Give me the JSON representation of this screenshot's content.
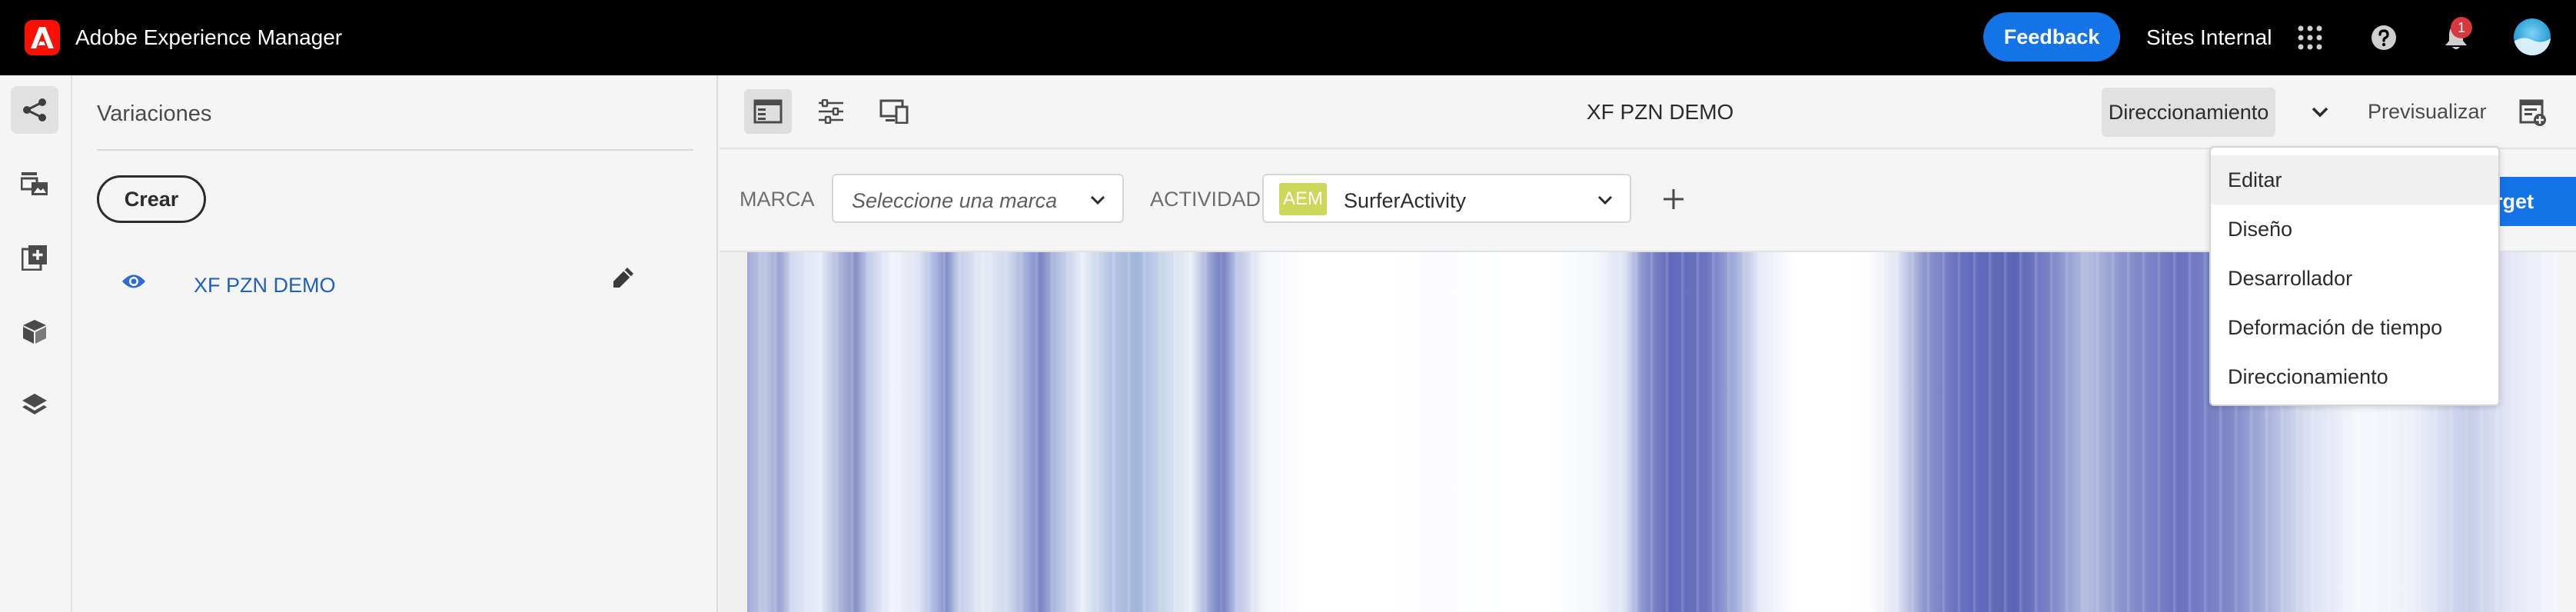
{
  "shell": {
    "app_title": "Adobe Experience Manager",
    "feedback_label": "Feedback",
    "org_label": "Sites Internal",
    "notification_count": "1",
    "icons": [
      "adobe-logo",
      "apps-grid-icon",
      "help-icon",
      "bell-icon",
      "avatar"
    ]
  },
  "rail": {
    "items": [
      "share-icon",
      "image-layout-icon",
      "add-page-icon",
      "package-icon",
      "layers-icon"
    ],
    "active_index": 0
  },
  "panel": {
    "title": "Variaciones",
    "create_label": "Crear",
    "variations": [
      {
        "label": "XF PZN DEMO"
      }
    ]
  },
  "toolbar": {
    "doc_title": "XF PZN DEMO",
    "mode_label": "Direccionamiento",
    "preview_label": "Previsualizar"
  },
  "targeting": {
    "brand_label": "MARCA",
    "brand_placeholder": "Seleccione una marca",
    "activity_label": "ACTIVIDAD",
    "activity_tag": "AEM",
    "activity_value": "SurferActivity",
    "target_button_label": "rget"
  },
  "mode_menu": {
    "items": [
      "Editar",
      "Diseño",
      "Desarrollador",
      "Deformación de tiempo",
      "Direccionamiento"
    ],
    "hover_index": 0
  },
  "colors": {
    "accent": "#1473e6",
    "shell_bg": "#000000",
    "brand_red": "#fa0f00",
    "link": "#1f5fbf",
    "badge": "#d7373f",
    "aem_tag": "#cbd85a"
  }
}
